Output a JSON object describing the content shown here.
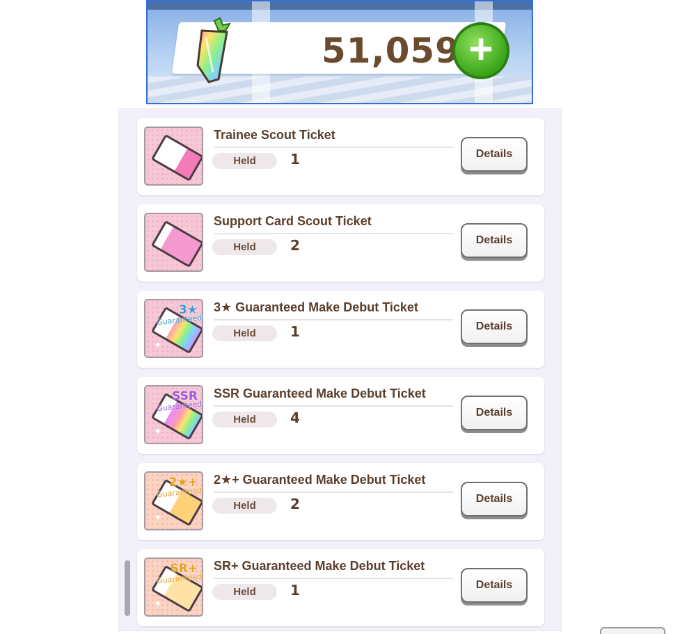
{
  "currency": {
    "amount": "51,059",
    "icon": "rainbow-crystal-icon",
    "add_icon": "plus-icon"
  },
  "colors": {
    "accent_green": "#3aa51a",
    "text_brown": "#5a3e2b",
    "panel_bg": "#f2f0f8"
  },
  "items": [
    {
      "title": "Trainee Scout Ticket",
      "held_label": "Held",
      "held_count": "1",
      "details_label": "Details"
    },
    {
      "title": "Support Card Scout Ticket",
      "held_label": "Held",
      "held_count": "2",
      "details_label": "Details"
    },
    {
      "title": "3★ Guaranteed Make Debut Ticket",
      "held_label": "Held",
      "held_count": "1",
      "details_label": "Details",
      "badge": "3★",
      "badge_sub": "Guaranteed"
    },
    {
      "title": "SSR Guaranteed Make Debut Ticket",
      "held_label": "Held",
      "held_count": "4",
      "details_label": "Details",
      "badge": "SSR",
      "badge_sub": "Guaranteed"
    },
    {
      "title": "2★+ Guaranteed Make Debut Ticket",
      "held_label": "Held",
      "held_count": "2",
      "details_label": "Details",
      "badge": "2★+",
      "badge_sub": "Guaranteed"
    },
    {
      "title": "SR+ Guaranteed Make Debut Ticket",
      "held_label": "Held",
      "held_count": "1",
      "details_label": "Details",
      "badge": "SR+",
      "badge_sub": "Guaranteed"
    }
  ]
}
